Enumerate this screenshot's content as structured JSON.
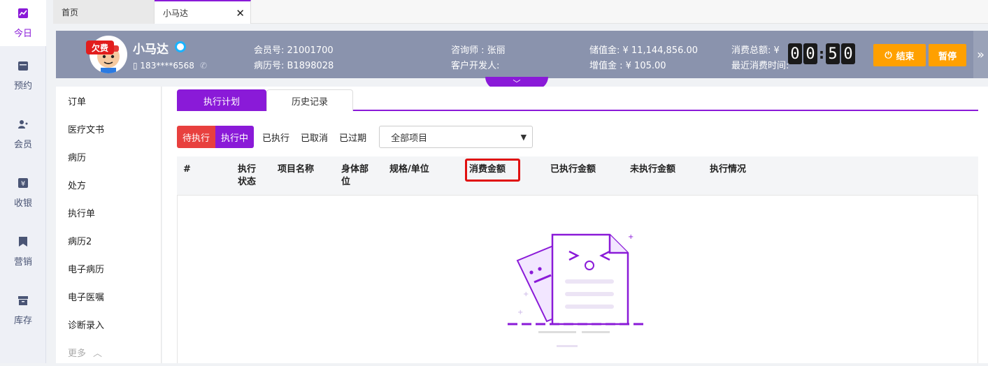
{
  "leftnav": {
    "items": [
      {
        "label": "今日",
        "icon": "chart-icon"
      },
      {
        "label": "预约",
        "icon": "calendar-icon"
      },
      {
        "label": "会员",
        "icon": "users-icon"
      },
      {
        "label": "收银",
        "icon": "yen-icon"
      },
      {
        "label": "营销",
        "icon": "bookmark-icon"
      },
      {
        "label": "库存",
        "icon": "box-icon"
      }
    ]
  },
  "tabs": {
    "home": "首页",
    "current": "小马达"
  },
  "header": {
    "owe_badge": "欠费",
    "name": "小马达",
    "phone": "183****6568",
    "member_no": "会员号:  21001700",
    "record_no": "病历号:  B1898028",
    "consultant": "咨询师  :  张丽",
    "developer": "客户开发人:",
    "stored_value": "储值金:  ¥ 11,144,856.00",
    "added_value": "增值金  :  ¥ 105.00",
    "total_consume": "消费总额:  ¥",
    "last_consume": "最近消费时间:",
    "timer": [
      "0",
      "0",
      "5",
      "0"
    ],
    "end_label": "结束",
    "pause_label": "暂停"
  },
  "submenu": {
    "items": [
      "订单",
      "医疗文书",
      "病历",
      "处方",
      "执行单",
      "病历2",
      "电子病历",
      "电子医嘱",
      "诊断录入"
    ],
    "more": "更多"
  },
  "content": {
    "tabs": [
      "执行计划",
      "历史记录"
    ],
    "filters": [
      "待执行",
      "执行中",
      "已执行",
      "已取消",
      "已过期"
    ],
    "select_value": "全部项目",
    "columns": [
      "#",
      "执行\n状态",
      "项目名称",
      "身体部\n位",
      "规格/单位",
      "消费金额",
      "已执行金额",
      "未执行金额",
      "执行情况"
    ]
  },
  "colors": {
    "accent": "#8a1ad8",
    "header_bg": "#8a93ad",
    "orange": "#ffa000",
    "red": "#e8403e"
  }
}
